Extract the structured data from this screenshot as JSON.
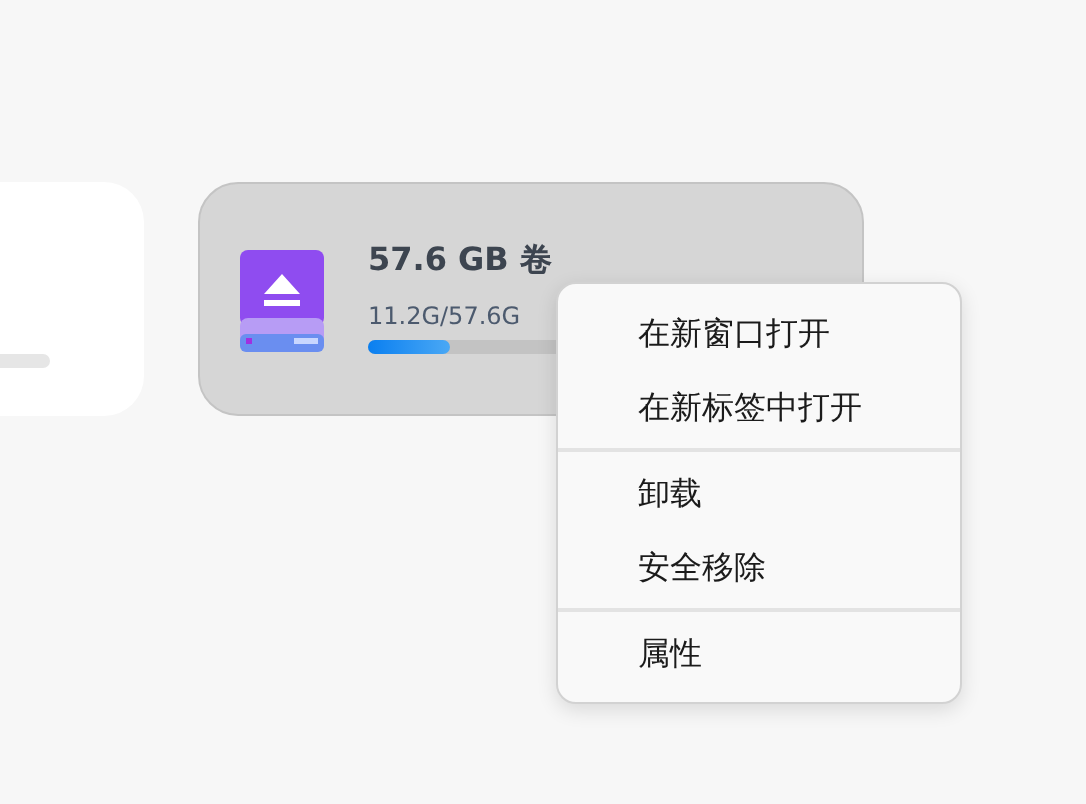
{
  "devices": [
    {
      "partial": true,
      "highlighted": false
    },
    {
      "name": "57.6 GB 卷",
      "usage": "11.2G/57.6G",
      "level": 0.18,
      "partial": false,
      "highlighted": true
    }
  ],
  "context_menu": {
    "groups": [
      [
        "在新窗口打开",
        "在新标签中打开"
      ],
      [
        "卸载",
        "安全移除"
      ],
      [
        "属性"
      ]
    ]
  }
}
